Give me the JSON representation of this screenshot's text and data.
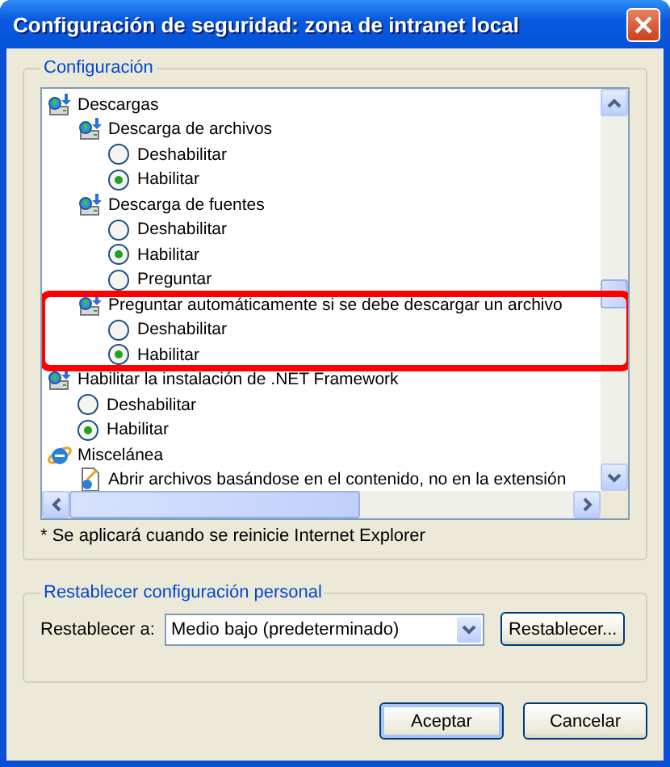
{
  "window": {
    "title": "Configuración de seguridad: zona de intranet local"
  },
  "settings": {
    "legend": "Configuración",
    "tree": [
      {
        "kind": "download",
        "label": "Descargas",
        "children": [
          {
            "kind": "download",
            "label": "Descarga de archivos",
            "children": [
              {
                "kind": "option",
                "label": "Deshabilitar",
                "selected": false
              },
              {
                "kind": "option",
                "label": "Habilitar",
                "selected": true
              }
            ]
          },
          {
            "kind": "download",
            "label": "Descarga de fuentes",
            "children": [
              {
                "kind": "option",
                "label": "Deshabilitar",
                "selected": false
              },
              {
                "kind": "option",
                "label": "Habilitar",
                "selected": true
              },
              {
                "kind": "option",
                "label": "Preguntar",
                "selected": false
              }
            ]
          },
          {
            "kind": "download",
            "label": "Preguntar automáticamente si se debe descargar un archivo",
            "highlighted": true,
            "children": [
              {
                "kind": "option",
                "label": "Deshabilitar",
                "selected": false
              },
              {
                "kind": "option",
                "label": "Habilitar",
                "selected": true
              }
            ]
          }
        ]
      },
      {
        "kind": "download",
        "label": "Habilitar la instalación de .NET Framework",
        "children": [
          {
            "kind": "option",
            "label": "Deshabilitar",
            "selected": false
          },
          {
            "kind": "option",
            "label": "Habilitar",
            "selected": true
          }
        ]
      },
      {
        "kind": "browser",
        "label": "Miscelánea",
        "children": [
          {
            "kind": "file",
            "label": "Abrir archivos basándose en el contenido, no en la extensión"
          }
        ]
      }
    ],
    "note": "* Se aplicará cuando se reinicie Internet Explorer"
  },
  "reset": {
    "legend": "Restablecer configuración personal",
    "label": "Restablecer a:",
    "value": "Medio bajo (predeterminado)",
    "button": "Restablecer..."
  },
  "buttons": [
    "Aceptar",
    "Cancelar"
  ]
}
